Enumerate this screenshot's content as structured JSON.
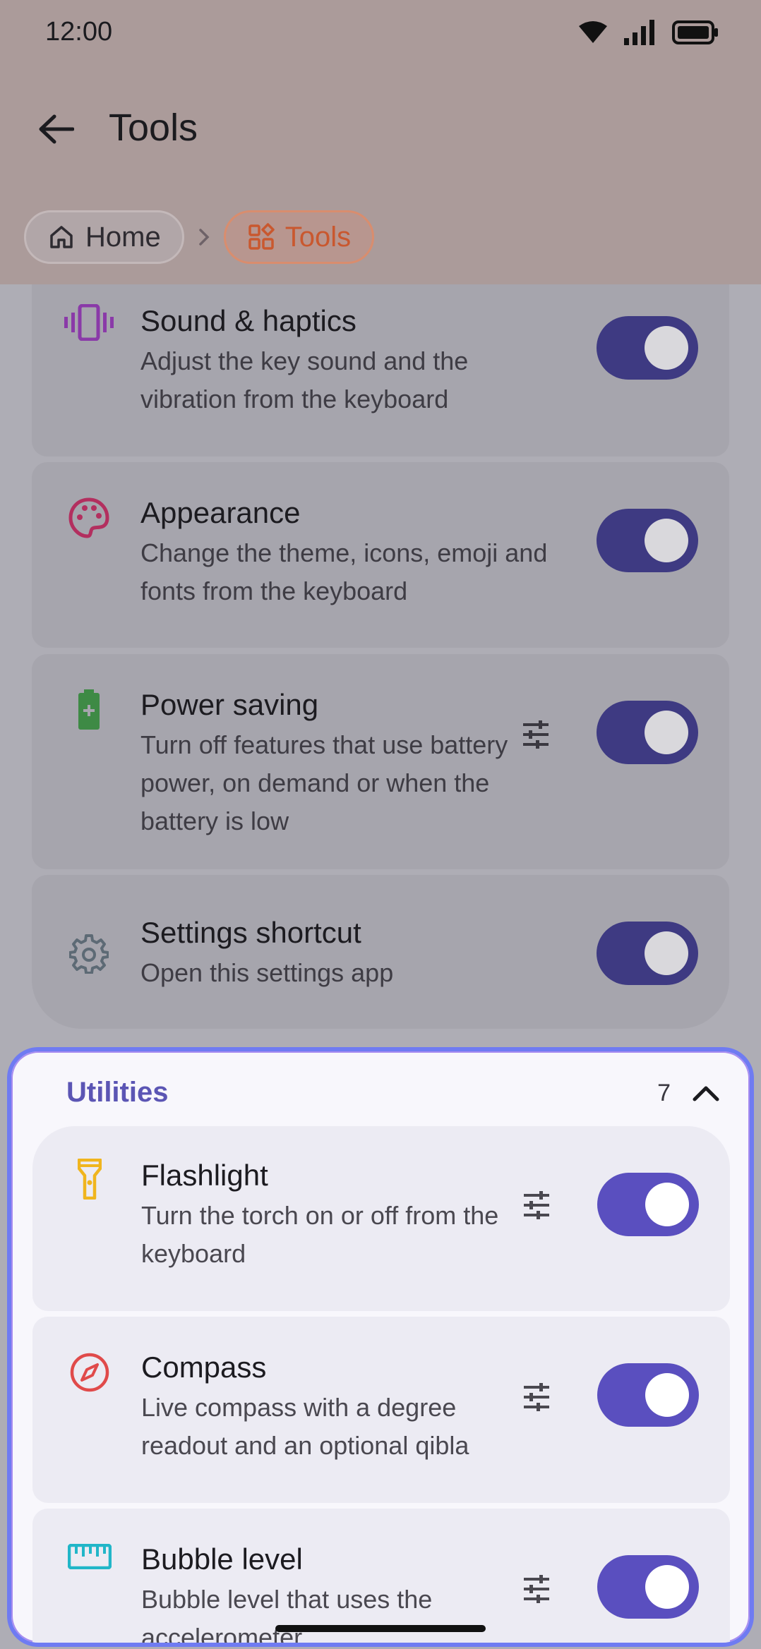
{
  "status": {
    "time": "12:00"
  },
  "header": {
    "title": "Tools"
  },
  "breadcrumb": {
    "home": "Home",
    "current": "Tools"
  },
  "settings": [
    {
      "title": "Sound & haptics",
      "desc": "Adjust the key sound and the vibration from the keyboard",
      "icon": "vibration-icon",
      "enabled": true
    },
    {
      "title": "Appearance",
      "desc": "Change the theme, icons, emoji and fonts from the keyboard",
      "icon": "palette-icon",
      "enabled": true
    },
    {
      "title": "Power saving",
      "desc": "Turn off features that use battery power, on demand or when the battery is low",
      "icon": "battery-saver-icon",
      "enabled": true
    },
    {
      "title": "Settings shortcut",
      "desc": "Open this settings app",
      "icon": "gear-icon",
      "enabled": true
    }
  ],
  "utilities": {
    "label": "Utilities",
    "count": "7",
    "items": [
      {
        "title": "Flashlight",
        "desc": "Turn the torch on or off from the keyboard",
        "icon": "flashlight-icon",
        "enabled": true
      },
      {
        "title": "Compass",
        "desc": "Live compass with a degree readout and an optional qibla",
        "icon": "compass-icon",
        "enabled": true
      },
      {
        "title": "Bubble level",
        "desc": "Bubble level that uses the accelerometer",
        "icon": "ruler-icon",
        "enabled": true
      }
    ]
  },
  "colors": {
    "accent": "#5a4fbf",
    "breadcrumb_active": "#c9582f",
    "panel_border": "#6f7bf2"
  }
}
